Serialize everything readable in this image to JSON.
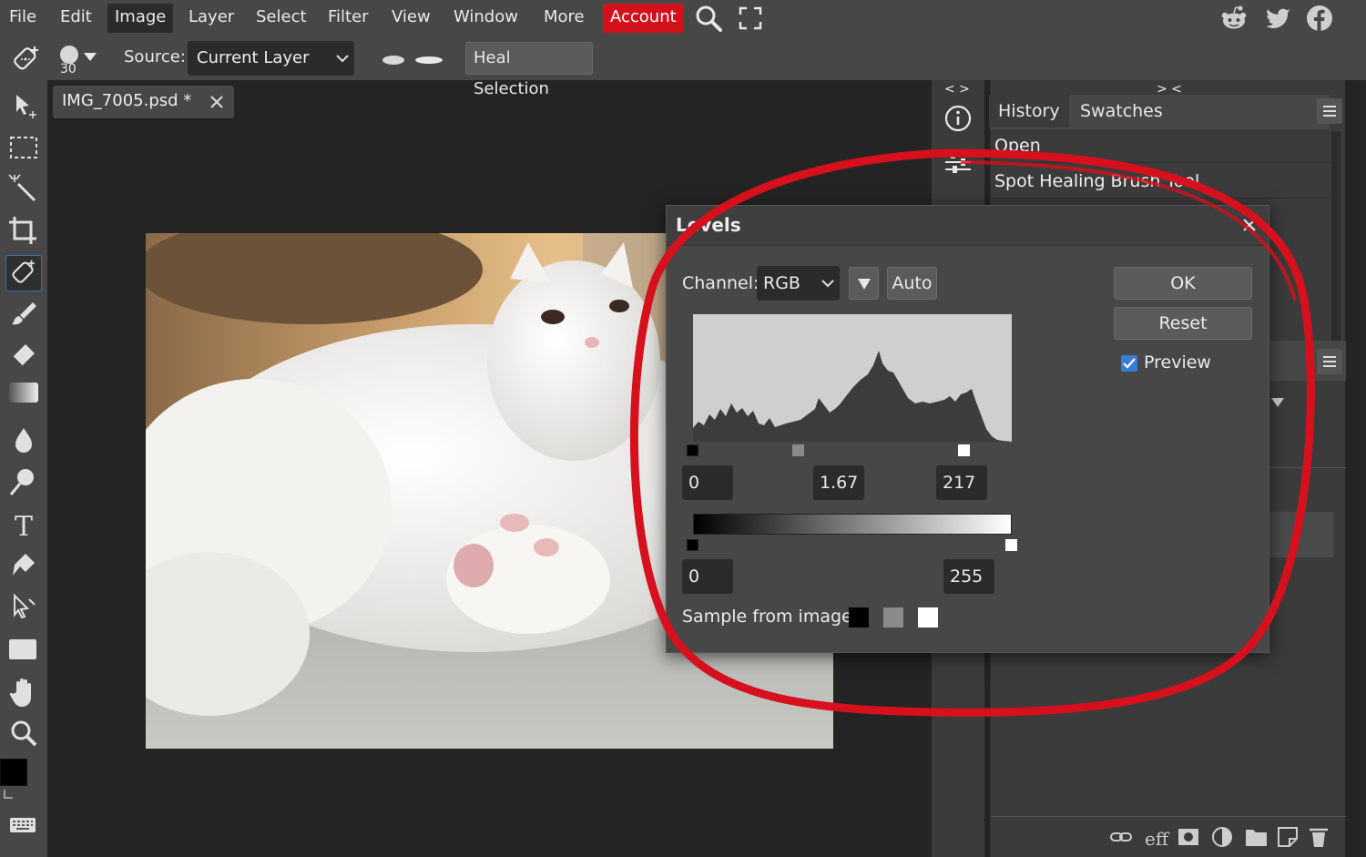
{
  "menu": {
    "items": [
      "File",
      "Edit",
      "Image",
      "Layer",
      "Select",
      "Filter",
      "View",
      "Window",
      "More"
    ],
    "account": "Account"
  },
  "options": {
    "brush_size": "30",
    "source_label": "Source:",
    "source_value": "Current Layer",
    "heal_button": "Heal Selection"
  },
  "document": {
    "tab_title": "IMG_7005.psd *"
  },
  "panel": {
    "collapse_left": "< >",
    "collapse_right": "> <",
    "tabs": [
      "History",
      "Swatches"
    ],
    "history": [
      "Open",
      "Spot Healing Brush Tool"
    ]
  },
  "levels": {
    "title": "Levels",
    "channel_label": "Channel:",
    "channel_value": "RGB",
    "auto_button": "Auto",
    "ok_button": "OK",
    "reset_button": "Reset",
    "preview_label": "Preview",
    "preview_checked": true,
    "input_black": "0",
    "input_gamma": "1.67",
    "input_white": "217",
    "output_black": "0",
    "output_white": "255",
    "sample_label": "Sample from image:"
  },
  "colors": {
    "accent_red": "#d3111d",
    "annotation_red": "#d6101c",
    "checkbox_blue": "#3a7bd5"
  }
}
